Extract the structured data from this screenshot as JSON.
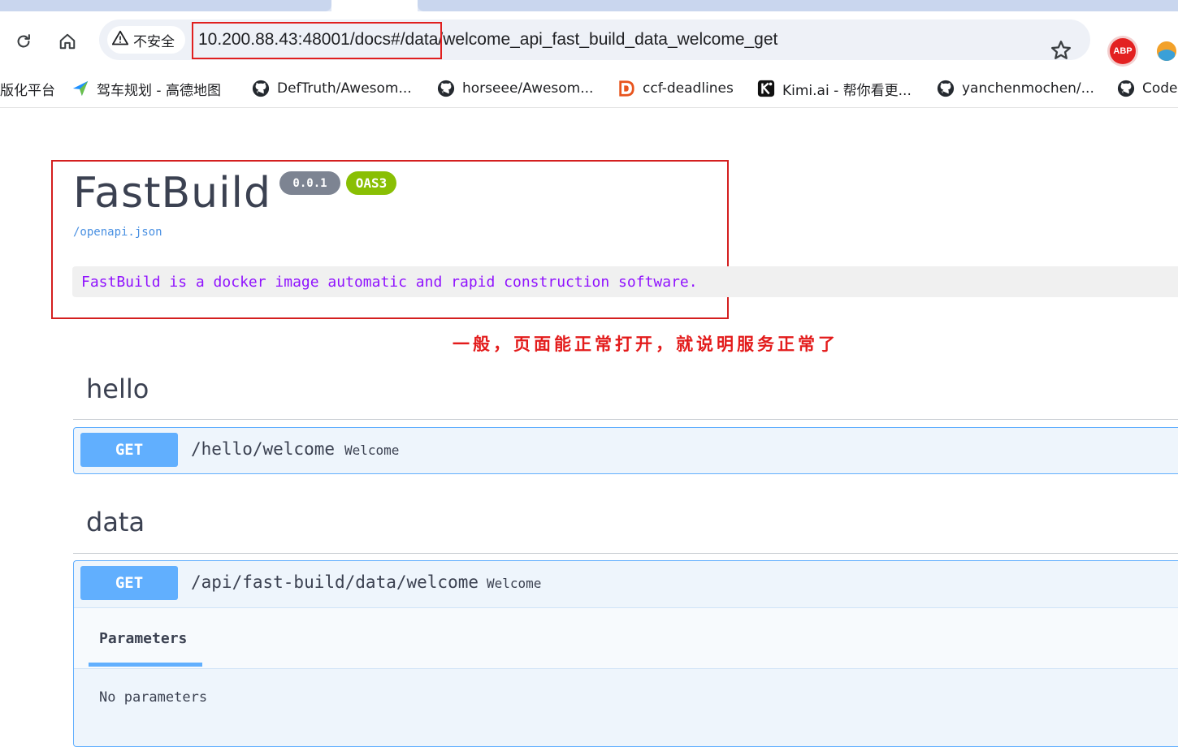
{
  "browser": {
    "url": "10.200.88.43:48001/docs#/data/welcome_api_fast_build_data_welcome_get",
    "security_label": "不安全",
    "extension_abp": "ABP",
    "bookmarks": [
      {
        "label": "版化平台",
        "icon": "none"
      },
      {
        "label": "驾车规划 - 高德地图",
        "icon": "amap-icon"
      },
      {
        "label": "DefTruth/Awesom...",
        "icon": "github-icon"
      },
      {
        "label": "horseee/Awesom...",
        "icon": "github-icon"
      },
      {
        "label": "ccf-deadlines",
        "icon": "ccf-icon"
      },
      {
        "label": "Kimi.ai - 帮你看更...",
        "icon": "kimi-icon"
      },
      {
        "label": "yanchenmochen/...",
        "icon": "github-icon"
      },
      {
        "label": "Code",
        "icon": "github-icon"
      }
    ]
  },
  "info": {
    "title": "FastBuild",
    "version": "0.0.1",
    "oas_badge": "OAS3",
    "spec_link": "/openapi.json",
    "description": "FastBuild is a docker image automatic and rapid construction software."
  },
  "annotation": "一般，页面能正常打开，就说明服务正常了",
  "sections": [
    {
      "name": "hello",
      "operation": {
        "method": "GET",
        "path": "/hello/welcome",
        "summary": "Welcome"
      }
    },
    {
      "name": "data",
      "operation": {
        "method": "GET",
        "path": "/api/fast-build/data/welcome",
        "summary": "Welcome"
      },
      "parameters_tab": "Parameters",
      "no_parameters": "No parameters"
    }
  ],
  "colors": {
    "get_method": "#61affe",
    "oas_badge": "#89bf04",
    "version_badge": "#7d8492",
    "description_text": "#9012fe",
    "annotation": "#e31b1b"
  }
}
